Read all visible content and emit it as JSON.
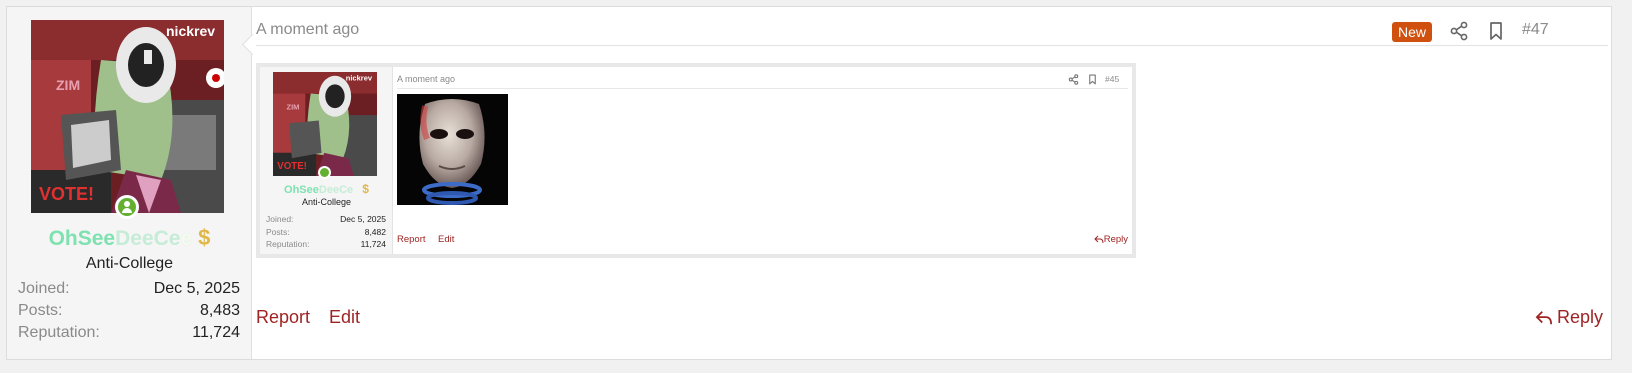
{
  "user": {
    "name_parts": [
      "OhSee",
      "DeeCe",
      "e"
    ],
    "dollar": "$",
    "title": "Anti-College",
    "stats": [
      {
        "label": "Joined:",
        "value": "Dec 5, 2025"
      },
      {
        "label": "Posts:",
        "value": "8,483"
      },
      {
        "label": "Reputation:",
        "value": "11,724"
      }
    ]
  },
  "header": {
    "time": "A moment ago",
    "badge": "New",
    "post_number": "#47"
  },
  "quote": {
    "user": {
      "name_parts": [
        "OhSee",
        "DeeCe",
        "e"
      ],
      "dollar": "$",
      "title": "Anti-College",
      "stats": [
        {
          "label": "Joined:",
          "value": "Dec 5, 2025"
        },
        {
          "label": "Posts:",
          "value": "8,482"
        },
        {
          "label": "Reputation:",
          "value": "11,724"
        }
      ]
    },
    "time": "A moment ago",
    "post_number": "#45",
    "actions": {
      "report": "Report",
      "edit": "Edit",
      "reply": "Reply"
    }
  },
  "actions": {
    "report": "Report",
    "edit": "Edit",
    "reply": "Reply"
  },
  "colors": {
    "accent": "#9e2424",
    "badge": "#d0510f",
    "online": "#63b030"
  }
}
